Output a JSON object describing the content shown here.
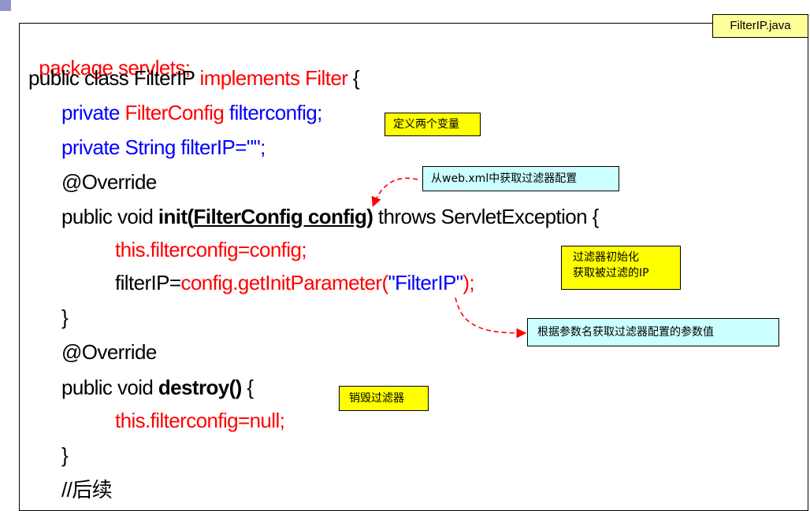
{
  "file_tab": "FilterIP.java",
  "code": {
    "l1": {
      "kw": "package servlets;"
    },
    "l2": {
      "a": "public class FilterIP ",
      "b": "implements Filter",
      "c": " {"
    },
    "l3": {
      "a": "private ",
      "b": "FilterConfig",
      "c": " filterconfig;"
    },
    "l4": {
      "a": "private String filterIP=\"\";"
    },
    "l5": {
      "a": "@Override"
    },
    "l6": {
      "a": "public void ",
      "b": "init(",
      "c": "FilterConfig config",
      "d": ")",
      "e": " throws ServletException {"
    },
    "l7": {
      "a": "this.filterconfig=config;"
    },
    "l8": {
      "a": "filterIP=",
      "b": "config.getInitParameter(",
      "c": "\"FilterIP\"",
      "d": ");"
    },
    "l9": {
      "a": "}"
    },
    "l10": {
      "a": "@Override"
    },
    "l11": {
      "a": "public void ",
      "b": "destroy()",
      "c": " {"
    },
    "l12": {
      "a": "this.filterconfig=null;"
    },
    "l13": {
      "a": "}"
    },
    "l14": {
      "a": "//后续"
    }
  },
  "notes": {
    "define_vars": "定义两个变量",
    "from_webxml": "从web.xml中获取过滤器配置",
    "init_line1": "过滤器初始化",
    "init_line2": "获取被过滤的IP",
    "get_param": "根据参数名获取过滤器配置的参数值",
    "destroy": "销毁过滤器"
  },
  "colors": {
    "keyword_red": "#ff0000",
    "keyword_blue": "#0000ff",
    "note_yellow": "#ffff00",
    "note_cyan": "#ccffff",
    "tab_yellow": "#ffff99",
    "corner_accent": "#8f94cc"
  }
}
